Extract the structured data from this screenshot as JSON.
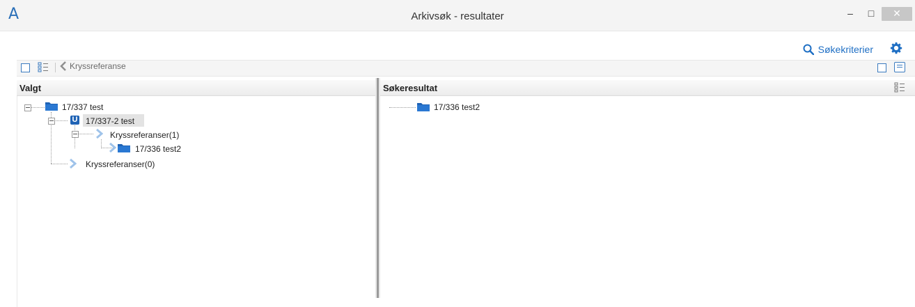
{
  "window": {
    "title": "Arkivsøk - resultater",
    "logo_letter": "A",
    "controls": {
      "minimize": "–",
      "maximize": "□",
      "close": "✕"
    }
  },
  "search_bar": {
    "criteria_label": "Søkekriterier",
    "icons": [
      "search-icon",
      "gear-icon"
    ],
    "accent_color": "#1f6fc4"
  },
  "toolbar": {
    "back_label": "Kryssreferanse",
    "icons": [
      "checkbox-icon",
      "list-view-icon",
      "chevron-left-icon",
      "checkbox-icon",
      "comment-icon"
    ]
  },
  "left_pane": {
    "title": "Valgt",
    "tree": {
      "root": {
        "label": "17/337 test",
        "icon": "folder-icon"
      },
      "child": {
        "label": "17/337-2 test",
        "badge": "U",
        "selected": true
      },
      "xref_child": {
        "label": "Kryssreferanser(1)",
        "icon": "chevron-right-icon"
      },
      "xref_leaf": {
        "label": "17/336 test2",
        "icon": "folder-icon"
      },
      "xref_root": {
        "label": "Kryssreferanser(0)",
        "icon": "chevron-right-icon"
      }
    }
  },
  "right_pane": {
    "title": "Søkeresultat",
    "results": [
      {
        "label": "17/336 test2",
        "icon": "folder-icon"
      }
    ]
  }
}
